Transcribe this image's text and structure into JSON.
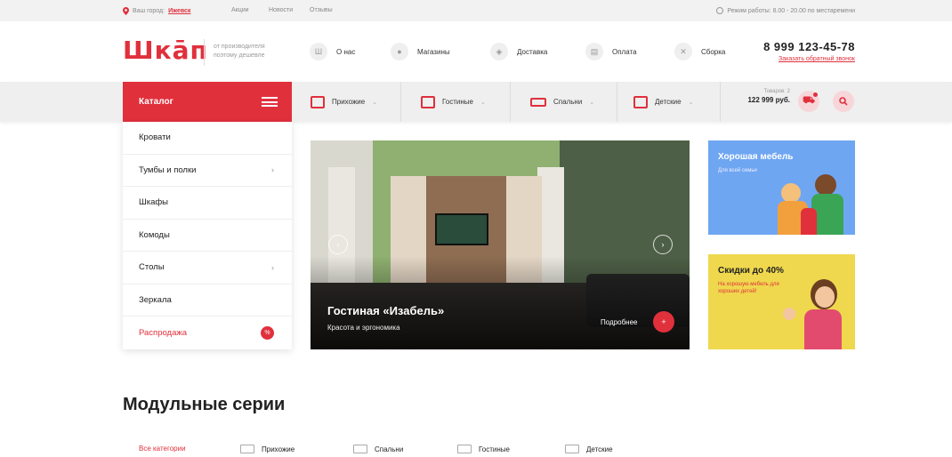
{
  "topbar": {
    "city_label": "Ваш город:",
    "city": "Ижевск",
    "links": [
      "Акции",
      "Новости",
      "Отзывы"
    ],
    "hours": "Режим работы: 8.00 - 20.00 по местаремени"
  },
  "header": {
    "logo": "Шкāп",
    "tagline": "от производителя поэтому дешевле",
    "nav": [
      {
        "icon": "Ш",
        "label": "О нас"
      },
      {
        "icon": "pin",
        "label": "Магазины"
      },
      {
        "icon": "box",
        "label": "Доставка"
      },
      {
        "icon": "wallet",
        "label": "Оплата"
      },
      {
        "icon": "tools",
        "label": "Сборка"
      }
    ],
    "phone": "8 999 123-45-78",
    "callback": "Заказать обратный звонок"
  },
  "menu": {
    "catalog": "Каталог",
    "items": [
      "Прихожие",
      "Гостиные",
      "Спальни",
      "Детские"
    ],
    "cart_count": "Товаров: 2",
    "cart_sum": "122 999 руб."
  },
  "sidebar": {
    "items": [
      {
        "label": "Кровати"
      },
      {
        "label": "Тумбы и полки",
        "arrow": "›"
      },
      {
        "label": "Шкафы"
      },
      {
        "label": "Комоды"
      },
      {
        "label": "Столы",
        "arrow": "›"
      },
      {
        "label": "Зеркала"
      },
      {
        "label": "Распродажа",
        "badge": "%"
      }
    ]
  },
  "slider": {
    "title": "Гостиная «Изабель»",
    "subtitle": "Красота и эргономика",
    "more": "Подробнее",
    "plus": "+"
  },
  "promos": [
    {
      "title": "Хорошая мебель",
      "subtitle": "Для всей семьи",
      "color": "#6fa6f2"
    },
    {
      "title": "Скидки до 40%",
      "subtitle": "На хорошую мебель для хороших детей!",
      "color": "#efd84e"
    }
  ],
  "section": {
    "title": "Модульные серии",
    "tabs": [
      "Все категории",
      "Прихожие",
      "Спальни",
      "Гостиные",
      "Детские"
    ]
  },
  "colors": {
    "accent": "#e0303c",
    "bar": "#efefef"
  }
}
